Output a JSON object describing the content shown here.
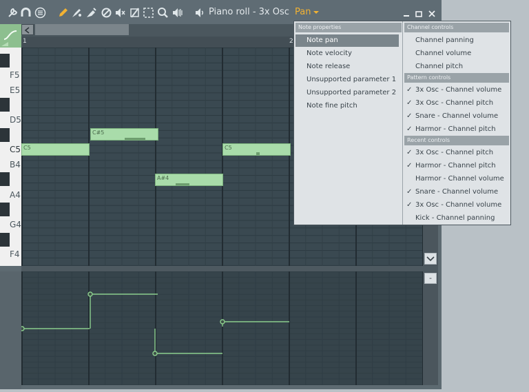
{
  "window": {
    "title": "Piano roll - 3x Osc",
    "param": "Pan",
    "toolbar_icons": [
      "wrench-icon",
      "magnet-icon",
      "menu-icon",
      "pencil-icon",
      "paint-icon",
      "stamp-icon",
      "delete-icon",
      "mute-icon",
      "slice-icon",
      "select-icon",
      "zoom-icon",
      "playback-icon"
    ]
  },
  "ruler": {
    "marks": [
      "1",
      "2"
    ]
  },
  "keyboard": {
    "labels": [
      "F5",
      "E5",
      "D5",
      "C5",
      "B4",
      "A4",
      "G4",
      "F4"
    ]
  },
  "notes": [
    {
      "label": "C5"
    },
    {
      "label": "C#5"
    },
    {
      "label": "A#4"
    },
    {
      "label": "C5"
    }
  ],
  "menu": {
    "left": {
      "header": "Note properties",
      "items": [
        {
          "label": "Note pan",
          "selected": true
        },
        {
          "label": "Note velocity"
        },
        {
          "label": "Note release"
        },
        {
          "label": "Unsupported parameter 1"
        },
        {
          "label": "Unsupported parameter 2"
        },
        {
          "label": "Note fine pitch"
        }
      ]
    },
    "right": {
      "channel_header": "Channel controls",
      "channel_items": [
        {
          "label": "Channel panning",
          "check": ""
        },
        {
          "label": "Channel volume",
          "check": ""
        },
        {
          "label": "Channel pitch",
          "check": ""
        }
      ],
      "pattern_header": "Pattern controls",
      "pattern_items": [
        {
          "label": "3x Osc - Channel volume",
          "check": "✓"
        },
        {
          "label": "3x Osc - Channel pitch",
          "check": "✓"
        },
        {
          "label": "Snare - Channel volume",
          "check": "✓"
        },
        {
          "label": "Harmor - Channel pitch",
          "check": "✓"
        }
      ],
      "recent_header": "Recent controls",
      "recent_items": [
        {
          "label": "3x Osc - Channel pitch",
          "check": "✓"
        },
        {
          "label": "Harmor - Channel pitch",
          "check": "✓"
        },
        {
          "label": "Harmor - Channel volume",
          "check": ""
        },
        {
          "label": "Snare - Channel volume",
          "check": "✓"
        },
        {
          "label": "3x Osc - Channel volume",
          "check": "✓"
        },
        {
          "label": "Kick - Channel panning",
          "check": ""
        }
      ]
    }
  },
  "event_editor": {
    "minus_label": "-"
  },
  "colors": {
    "accent": "#f2b233",
    "note": "#a9dcaa",
    "grid": "#3a4951"
  }
}
